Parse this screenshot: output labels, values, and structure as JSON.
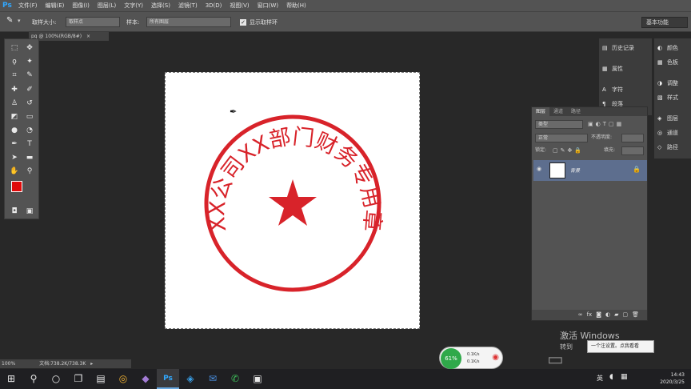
{
  "menubar": {
    "logo": "Ps",
    "items": [
      "文件(F)",
      "编辑(E)",
      "图像(I)",
      "图层(L)",
      "文字(Y)",
      "选择(S)",
      "滤镜(T)",
      "3D(D)",
      "视图(V)",
      "窗口(W)",
      "帮助(H)"
    ]
  },
  "options": {
    "sample_size_label": "取样大小:",
    "sample_size_value": "取样点",
    "sample_label": "样本:",
    "sample_value": "所有图层",
    "show_ring_label": "显示取样环",
    "workspace": "基本功能"
  },
  "document": {
    "tab_label": "pg @ 100%(RGB/8#)"
  },
  "status": {
    "zoom": "100%",
    "doc_info": "文档:738.2K/738.3K"
  },
  "stamp": {
    "arc_text": "XX公司XX部门财务专用章",
    "color": "#d8232a"
  },
  "panels_a": [
    {
      "icon": "history-icon",
      "glyph": "▤",
      "label": "历史记录"
    },
    {
      "icon": "properties-icon",
      "glyph": "▦",
      "label": "属性"
    },
    {
      "icon": "character-icon",
      "glyph": "A",
      "label": "字符"
    },
    {
      "icon": "paragraph-icon",
      "glyph": "¶",
      "label": "段落"
    }
  ],
  "panels_b": [
    {
      "icon": "color-icon",
      "glyph": "◐",
      "label": "颜色"
    },
    {
      "icon": "swatches-icon",
      "glyph": "▦",
      "label": "色板"
    },
    {
      "icon": "adjustments-icon",
      "glyph": "◑",
      "label": "调整"
    },
    {
      "icon": "styles-icon",
      "glyph": "▧",
      "label": "样式"
    },
    {
      "icon": "layers-icon",
      "glyph": "◈",
      "label": "图层"
    },
    {
      "icon": "channels-icon",
      "glyph": "◎",
      "label": "通道"
    },
    {
      "icon": "paths-icon",
      "glyph": "◇",
      "label": "路径"
    }
  ],
  "layers_panel": {
    "tabs": [
      "图层",
      "通道",
      "路径"
    ],
    "filter_kind": "类型",
    "blend_mode": "正常",
    "opacity_label": "不透明度:",
    "lock_label": "锁定:",
    "fill_label": "填充:",
    "layer_name": "背景"
  },
  "watermark": {
    "line1": "激活 Windows",
    "line2": "转到"
  },
  "tooltip": "一个注设置。点我看看",
  "network": {
    "percent": "61%",
    "up": "0.1K/s",
    "down": "0.1K/s"
  },
  "tray": {
    "lang": "英",
    "time": "14:43",
    "date": "2020/3/25"
  }
}
